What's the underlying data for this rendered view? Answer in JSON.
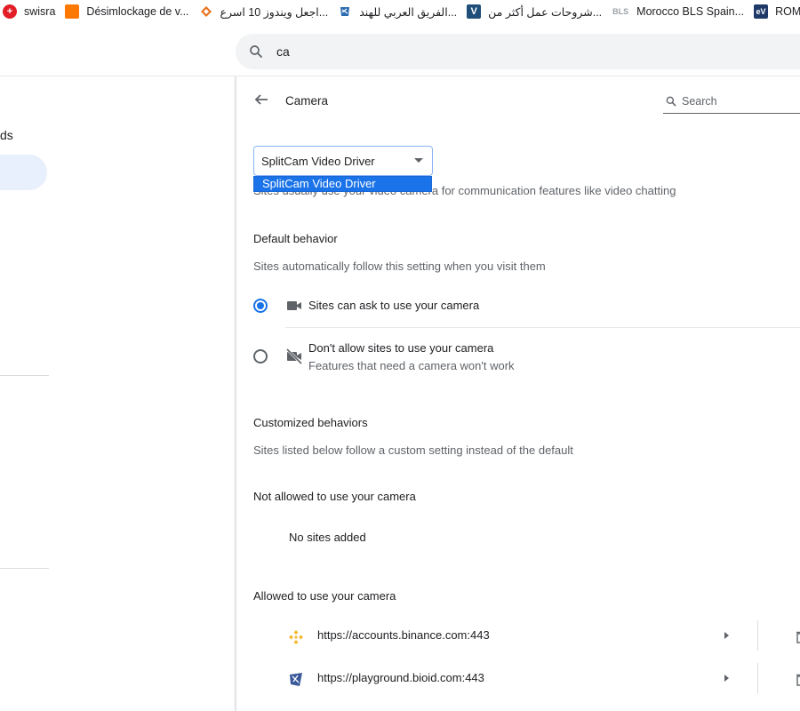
{
  "bookmarks": [
    {
      "label": "swisra",
      "icon": "swiss-flag-icon",
      "color": "#e21e26"
    },
    {
      "label": "Désimlockage de v...",
      "icon": "orange-brand-icon",
      "color": "#ff7900"
    },
    {
      "label": "اجعل ويندوز 10 اسرع...",
      "icon": "diamond-site-icon",
      "color": "#e8711a"
    },
    {
      "label": "الفريق العربي للهند...",
      "icon": "shield-site-icon",
      "color": "#2b6cb0"
    },
    {
      "label": "شروحات عمل أكثر من...",
      "icon": "v-site-icon",
      "color": "#1f4e79"
    },
    {
      "label": "Morocco BLS Spain...",
      "icon": "bls-icon",
      "color": "#9aa0a6"
    },
    {
      "label": "ROMANIA",
      "icon": "ev-icon",
      "color": "#1f3a68"
    }
  ],
  "search": {
    "value": "ca"
  },
  "nav": {
    "fragment": "ds"
  },
  "page": {
    "title": "Camera",
    "search_placeholder": "Search",
    "selected_device": "SplitCam Video Driver",
    "dropdown_options": [
      "SplitCam Video Driver"
    ],
    "description": "Sites usually use your video camera for communication features like video chatting"
  },
  "default_behavior": {
    "heading": "Default behavior",
    "subtext": "Sites automatically follow this setting when you visit them",
    "options": [
      {
        "label": "Sites can ask to use your camera",
        "sublabel": "",
        "checked": true
      },
      {
        "label": "Don't allow sites to use your camera",
        "sublabel": "Features that need a camera won't work",
        "checked": false
      }
    ]
  },
  "customized": {
    "heading": "Customized behaviors",
    "subtext": "Sites listed below follow a custom setting instead of the default",
    "not_allowed_label": "Not allowed to use your camera",
    "not_allowed_empty": "No sites added",
    "allowed_label": "Allowed to use your camera",
    "allowed_sites": [
      {
        "url": "https://accounts.binance.com:443",
        "icon": "binance-icon"
      },
      {
        "url": "https://playground.bioid.com:443",
        "icon": "bioid-icon"
      }
    ]
  },
  "colors": {
    "accent": "#1a73e8",
    "binance": "#f3ba2f",
    "bioid": "#3c5a99"
  }
}
